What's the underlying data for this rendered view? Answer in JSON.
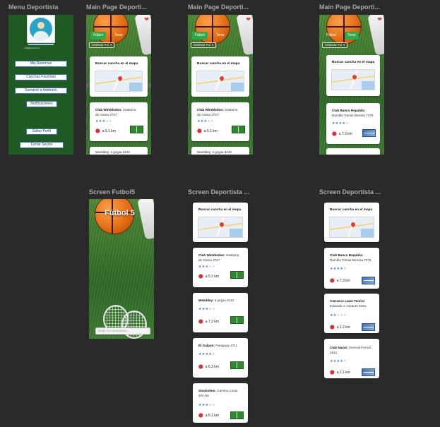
{
  "frames": {
    "menu": "Menu Deportista",
    "main1": "Main Page Deporti...",
    "main2": "Main Page Deporti...",
    "main3": "Main Page Deporti...",
    "futbol": "Screen Futbol5",
    "screen1": "Screen Deportista ...",
    "screen2": "Screen Deportista ..."
  },
  "menu": {
    "email": "mail@gmail.com",
    "buttons": [
      "Mis Reservas",
      "Canchas Favoritas",
      "Sumarse a Arbitrario",
      "Notificaciones",
      "Editar Perfil",
      "Cerrar Sesión"
    ]
  },
  "tabs": {
    "futbol": "Fútbol",
    "tenis": "Tenis"
  },
  "sort": "Ordenar Por",
  "map_card": {
    "title": "Buscar cancha en el mapa"
  },
  "venues_futbol": [
    {
      "name": "Club Wimbledon:",
      "addr": "Saldarria de Gama 3727",
      "stars": 3,
      "dist": "a 5.1 km"
    },
    {
      "name": "Wembley:",
      "addr": "4 jorjyiu 3142",
      "stars": 3,
      "dist": "a 7.3 km"
    },
    {
      "name": "El Galpon:",
      "addr": "Paraguay 2711",
      "stars": 4,
      "dist": "a 6.3 km"
    },
    {
      "name": "Stockolmo:",
      "addr": "Camino Costa 404 bis",
      "stars": 3,
      "dist": "a 5.1 km"
    }
  ],
  "venues_tenis": [
    {
      "name": "Club Banco Republic:",
      "addr": "Rambla Tomas Berreta 7378",
      "stars": 4,
      "dist": "a 7.3 km"
    },
    {
      "name": "Carrasco Lawn Tennis:",
      "addr": "Eduardo J. Couture 6401",
      "stars": 2,
      "dist": "a 1.2 km"
    },
    {
      "name": "Club Naval:",
      "addr": "General French 1641",
      "stars": 4,
      "dist": "a 2.1 km"
    }
  ],
  "futbol_screen": {
    "label": "Fútbol 5",
    "placeholder": "Dejar un comentario..."
  },
  "partials": {
    "main1": "Wembley: 4 jorjyiu 3142",
    "main2": "Wembley: 4 jorjyiu 3142"
  }
}
